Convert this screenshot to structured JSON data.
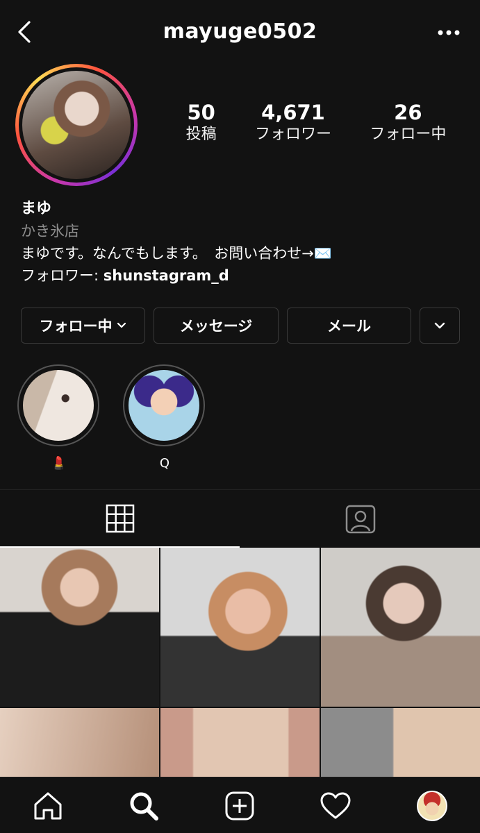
{
  "header": {
    "username": "mayuge0502",
    "back_icon": "chevron-left-icon",
    "more_icon": "more-horizontal-icon"
  },
  "profile": {
    "stats": [
      {
        "value": "50",
        "label": "投稿"
      },
      {
        "value": "4,671",
        "label": "フォロワー"
      },
      {
        "value": "26",
        "label": "フォロー中"
      }
    ],
    "name": "まゆ",
    "category": "かき氷店",
    "bio_line": "まゆです。なんでもします。　お問い合わせ→✉️",
    "followed_by_prefix": "フォロワー: ",
    "followed_by_name": "shunstagram_d"
  },
  "actions": {
    "follow_label": "フォロー中",
    "message_label": "メッセージ",
    "mail_label": "メール"
  },
  "highlights": [
    {
      "label": "💄"
    },
    {
      "label": "Q"
    }
  ],
  "tabs": {
    "active": "grid",
    "items": [
      "grid-icon",
      "tagged-icon"
    ]
  },
  "bottom_nav": [
    "home-icon",
    "search-icon",
    "add-post-icon",
    "heart-icon",
    "profile-avatar"
  ],
  "colors": {
    "background": "#121212",
    "text": "#ffffff",
    "muted": "#8e8e8e",
    "border": "#3a3a3a"
  }
}
